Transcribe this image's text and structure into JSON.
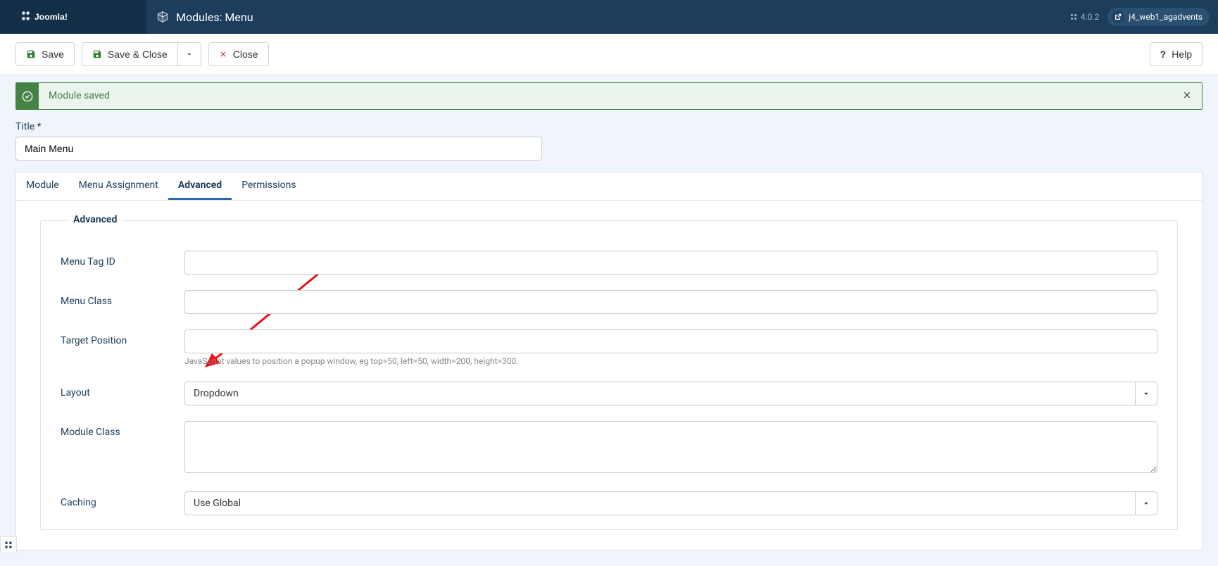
{
  "header": {
    "brand": "Joomla!",
    "page_title": "Modules: Menu",
    "version": "4.0.2",
    "user": "j4_web1_agadvents"
  },
  "toolbar": {
    "save": "Save",
    "save_close": "Save & Close",
    "close": "Close",
    "help": "Help"
  },
  "alert": {
    "message": "Module saved"
  },
  "form": {
    "title_label": "Title *",
    "title_value": "Main Menu"
  },
  "tabs": [
    {
      "label": "Module",
      "active": false
    },
    {
      "label": "Menu Assignment",
      "active": false
    },
    {
      "label": "Advanced",
      "active": true
    },
    {
      "label": "Permissions",
      "active": false
    }
  ],
  "fieldset": {
    "legend": "Advanced",
    "menu_tag_id_label": "Menu Tag ID",
    "menu_tag_id_value": "",
    "menu_class_label": "Menu Class",
    "menu_class_value": "",
    "target_position_label": "Target Position",
    "target_position_value": "",
    "target_position_help": "JavaScript values to position a popup window, eg top=50, left=50, width=200, height=300.",
    "layout_label": "Layout",
    "layout_value": "Dropdown",
    "module_class_label": "Module Class",
    "module_class_value": "",
    "caching_label": "Caching",
    "caching_value": "Use Global"
  }
}
